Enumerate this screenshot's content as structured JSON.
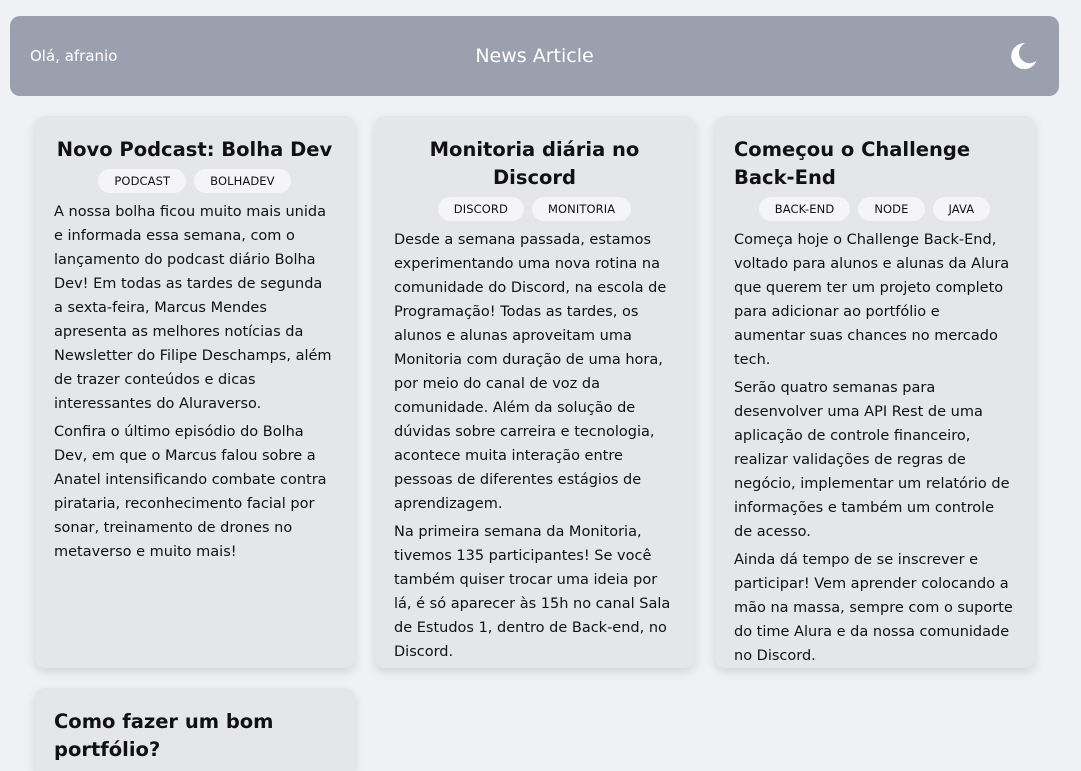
{
  "header": {
    "greeting": "Olá, afranio",
    "title": "News Article",
    "theme_toggle_icon": "moon-icon"
  },
  "articles": [
    {
      "title": "Novo Podcast: Bolha Dev",
      "tags": [
        "PODCAST",
        "BOLHADEV"
      ],
      "paragraphs": [
        "A nossa bolha ficou muito mais unida e informada essa semana, com o lançamento do podcast diário Bolha Dev! Em todas as tardes de segunda a sexta-feira, Marcus Mendes apresenta as melhores notícias da Newsletter do Filipe Deschamps, além de trazer conteúdos e dicas interessantes do Aluraverso.",
        "Confira o último episódio do Bolha Dev, em que o Marcus falou sobre a Anatel intensificando combate contra pirataria, reconhecimento facial por sonar, treinamento de drones no metaverso e muito mais!"
      ]
    },
    {
      "title": "Monitoria diária no Discord",
      "tags": [
        "DISCORD",
        "MONITORIA"
      ],
      "paragraphs": [
        "Desde a semana passada, estamos experimentando uma nova rotina na comunidade do Discord, na escola de Programação! Todas as tardes, os alunos e alunas aproveitam uma Monitoria com duração de uma hora, por meio do canal de voz da comunidade. Além da solução de dúvidas sobre carreira e tecnologia, acontece muita interação entre pessoas de diferentes estágios de aprendizagem.",
        "Na primeira semana da Monitoria, tivemos 135 participantes! Se você também quiser trocar uma ideia por lá, é só aparecer às 15h no canal Sala de Estudos 1, dentro de Back-end, no Discord."
      ]
    },
    {
      "title": "Começou o Challenge Back-End",
      "tags": [
        "BACK-END",
        "NODE",
        "JAVA"
      ],
      "paragraphs": [
        "Começa hoje o Challenge Back-End, voltado para alunos e alunas da Alura que querem ter um projeto completo para adicionar ao portfólio e aumentar suas chances no mercado tech.",
        "Serão quatro semanas para desenvolver uma API Rest de uma aplicação de controle financeiro, realizar validações de regras de negócio, implementar um relatório de informações e também um controle de acesso.",
        "Ainda dá tempo de se inscrever e participar! Vem aprender colocando a mão na massa, sempre com o suporte do time Alura e da nossa comunidade no Discord."
      ]
    },
    {
      "title": "Como fazer um bom portfólio?",
      "tags": [],
      "paragraphs": []
    }
  ]
}
